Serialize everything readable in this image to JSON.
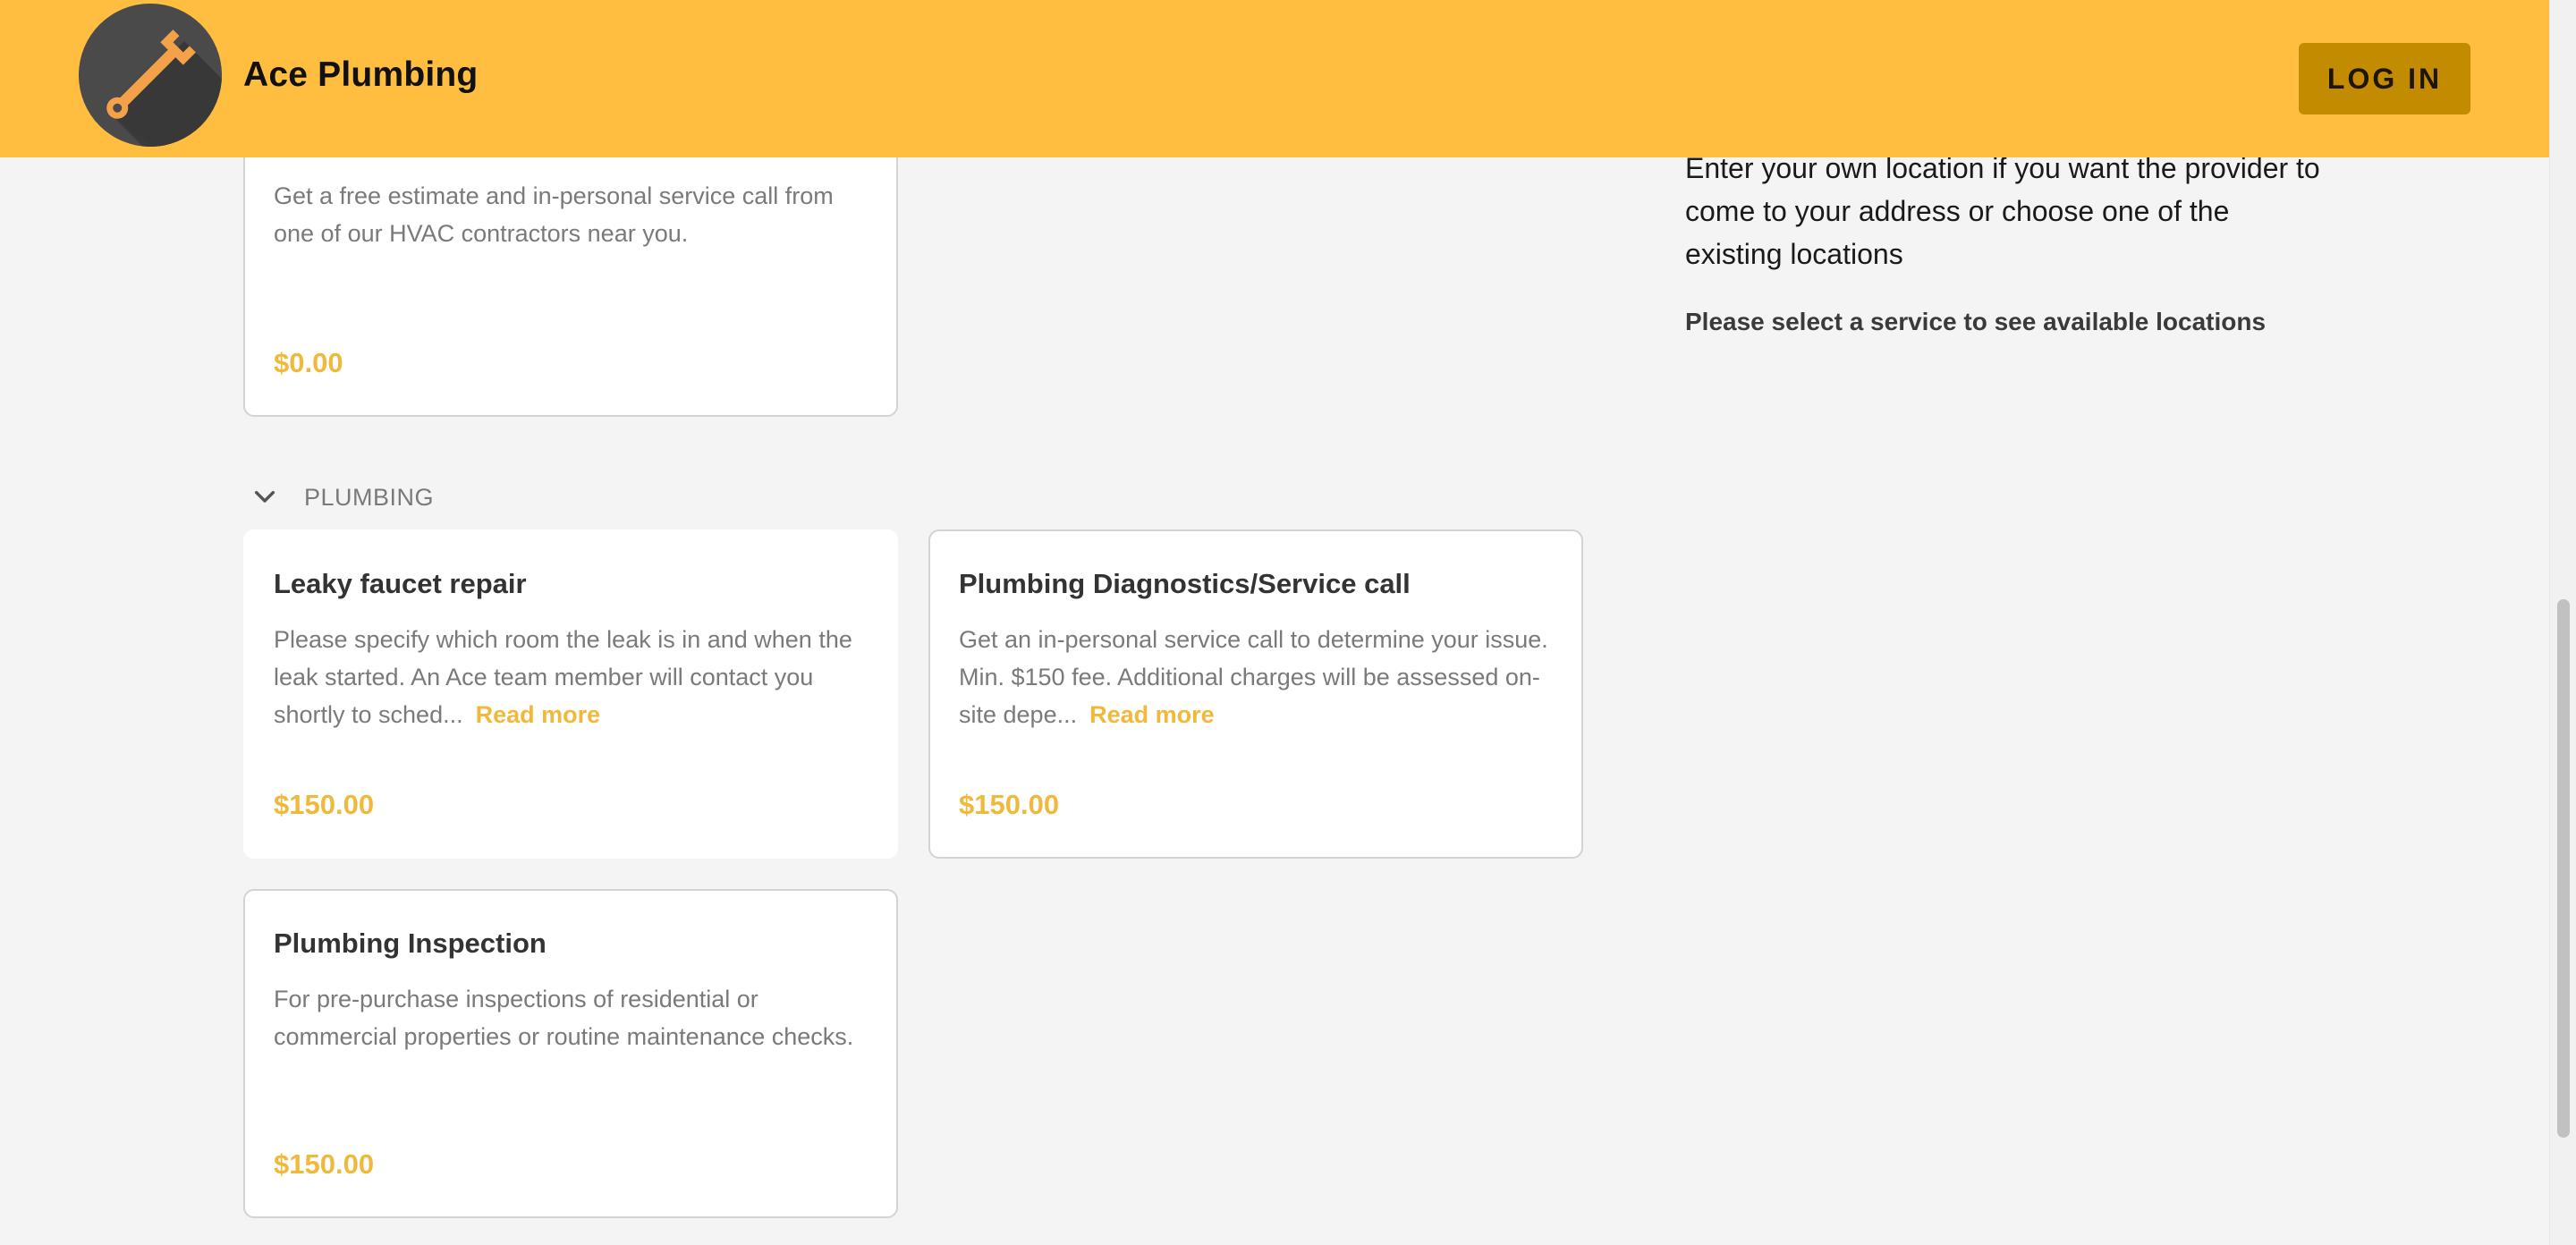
{
  "header": {
    "brand": "Ace Plumbing",
    "login_label": "LOG IN",
    "logo_icon": "wrench-icon"
  },
  "top_card": {
    "description": "Get a free estimate and in-personal service call from one of our HVAC contractors near you.",
    "price": "$0.00"
  },
  "category": {
    "label": "PLUMBING",
    "icon": "chevron-down-icon"
  },
  "services": [
    {
      "title": "Leaky faucet repair",
      "description": "Please specify which room the leak is in and when the leak started. An Ace team member will contact you shortly to sched...",
      "read_more": "Read more",
      "price": "$150.00"
    },
    {
      "title": "Plumbing Diagnostics/Service call",
      "description": "Get an in-personal service call to determine your issue. Min. $150 fee. Additional charges will be assessed on-site depe...",
      "read_more": "Read more",
      "price": "$150.00"
    },
    {
      "title": "Plumbing Inspection",
      "description": "For pre-purchase inspections of residential or commercial properties or routine maintenance checks.",
      "price": "$150.00"
    }
  ],
  "location_panel": {
    "instructions": "Enter your own location if you want the provider to come to your address or choose one of the existing locations",
    "note": "Please select a service to see available locations"
  },
  "colors": {
    "header_bg": "#ffbe3f",
    "login_bg": "#c38c00",
    "accent": "#f0b93b"
  }
}
